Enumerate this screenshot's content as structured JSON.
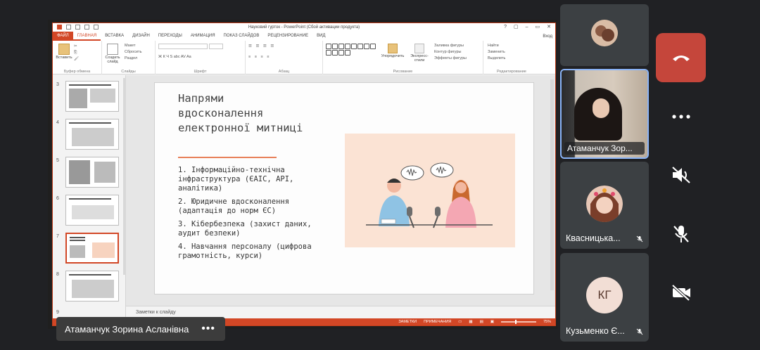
{
  "app": {
    "title": "Науковий гурток - PowerPoint (Сбой активации продукта)",
    "window_controls": [
      "?",
      "▢",
      "–",
      "▭",
      "✕"
    ],
    "user_label": "Вход"
  },
  "ribbon": {
    "tabs": [
      {
        "label": "ФАЙЛ",
        "state": "file"
      },
      {
        "label": "ГЛАВНАЯ",
        "state": "active"
      },
      {
        "label": "ВСТАВКА",
        "state": ""
      },
      {
        "label": "ДИЗАЙН",
        "state": ""
      },
      {
        "label": "ПЕРЕХОДЫ",
        "state": ""
      },
      {
        "label": "АНИМАЦИЯ",
        "state": ""
      },
      {
        "label": "ПОКАЗ СЛАЙДОВ",
        "state": ""
      },
      {
        "label": "РЕЦЕНЗИРОВАНИЕ",
        "state": ""
      },
      {
        "label": "ВИД",
        "state": ""
      }
    ],
    "clipboard": {
      "paste": "Вставить",
      "group": "Буфер обмена"
    },
    "slides": {
      "create": "Создать слайд",
      "layout": "Макет",
      "reset": "Сбросить",
      "section": "Раздел",
      "group": "Слайды"
    },
    "font": {
      "group": "Шрифт",
      "styles": "Ж  К  Ч  S  abc  AV  Aa"
    },
    "paragraph": {
      "group": "Абзац"
    },
    "drawing": {
      "arrange": "Упорядочить",
      "quick_styles": "Экспресс-стили",
      "fill": "Заливка фигуры",
      "outline": "Контур фигуры",
      "effects": "Эффекты фигуры",
      "group": "Рисование"
    },
    "editing": {
      "find": "Найти",
      "replace": "Заменить",
      "select": "Выделить",
      "group": "Редактирование"
    }
  },
  "thumbnails": [
    {
      "num": "3",
      "selected": false
    },
    {
      "num": "4",
      "selected": false
    },
    {
      "num": "5",
      "selected": false
    },
    {
      "num": "6",
      "selected": false
    },
    {
      "num": "7",
      "selected": true
    },
    {
      "num": "8",
      "selected": false
    },
    {
      "num": "9",
      "selected": false
    }
  ],
  "slide": {
    "title": "Напрями вдосконалення електронної митниці",
    "items": [
      "1. Інформаційно-технічна інфраструктура (ЄАІС, API, аналітика)",
      "2. Юридичне вдосконалення (адаптація до норм ЄС)",
      "3. Кібербезпека (захист даних, аудит безпеки)",
      "4. Навчання персоналу (цифрова грамотність, курси)"
    ]
  },
  "notes_placeholder": "Заметки к слайду",
  "statusbar": {
    "notes": "ЗАМЕТКИ",
    "comments": "ПРИМЕЧАНИЯ",
    "zoom": "75%"
  },
  "presenter": {
    "name": "Атаманчук Зорина Асланівна",
    "more": "•••"
  },
  "participants": [
    {
      "name": "",
      "kind": "avatar-photo"
    },
    {
      "name": "Атаманчук Зор...",
      "kind": "video",
      "active": true
    },
    {
      "name": "Квасницька...",
      "kind": "avatar-photo",
      "muted": true
    },
    {
      "name": "Кузьменко Є...",
      "kind": "initials",
      "initials": "КГ",
      "muted": true
    }
  ],
  "controls": [
    "end-call",
    "more",
    "speaker-off",
    "mic-off",
    "camera-off"
  ],
  "colors": {
    "ppt_accent": "#d24726",
    "end_call": "#c5463b",
    "active_tile": "#8ab4f8",
    "slide_accent": "#e8805a"
  }
}
